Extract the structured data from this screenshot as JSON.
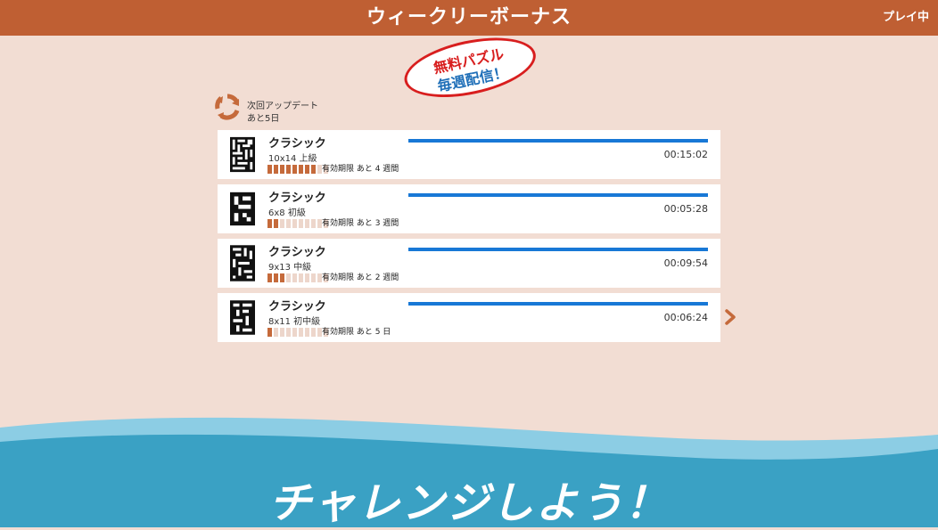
{
  "header": {
    "title": "ウィークリーボーナス",
    "status": "プレイ中"
  },
  "badge": {
    "line1": "無料パズル",
    "line2": "毎週配信！"
  },
  "update": {
    "label": "次回アップデート",
    "days": "あと5日",
    "icon": "refresh-icon"
  },
  "puzzles": [
    {
      "title": "クラシック",
      "size": "10x14 上級",
      "expiry": "有効期限 あと 4 週間",
      "time": "00:15:02",
      "filled": 8,
      "segments": 10
    },
    {
      "title": "クラシック",
      "size": "6x8 初級",
      "expiry": "有効期限 あと 3 週間",
      "time": "00:05:28",
      "filled": 2,
      "segments": 10
    },
    {
      "title": "クラシック",
      "size": "9x13 中級",
      "expiry": "有効期限 あと 2 週間",
      "time": "00:09:54",
      "filled": 3,
      "segments": 10
    },
    {
      "title": "クラシック",
      "size": "8x11 初中級",
      "expiry": "有効期限 あと 5 日",
      "time": "00:06:24",
      "filled": 1,
      "segments": 10
    }
  ],
  "next_icon": "chevron-right-icon",
  "footer": {
    "challenge": "チャレンジしよう！"
  },
  "colors": {
    "header": "#bf5f33",
    "background": "#f2ddd3",
    "progress": "#1878d6",
    "wave": "#3aa1c4"
  }
}
